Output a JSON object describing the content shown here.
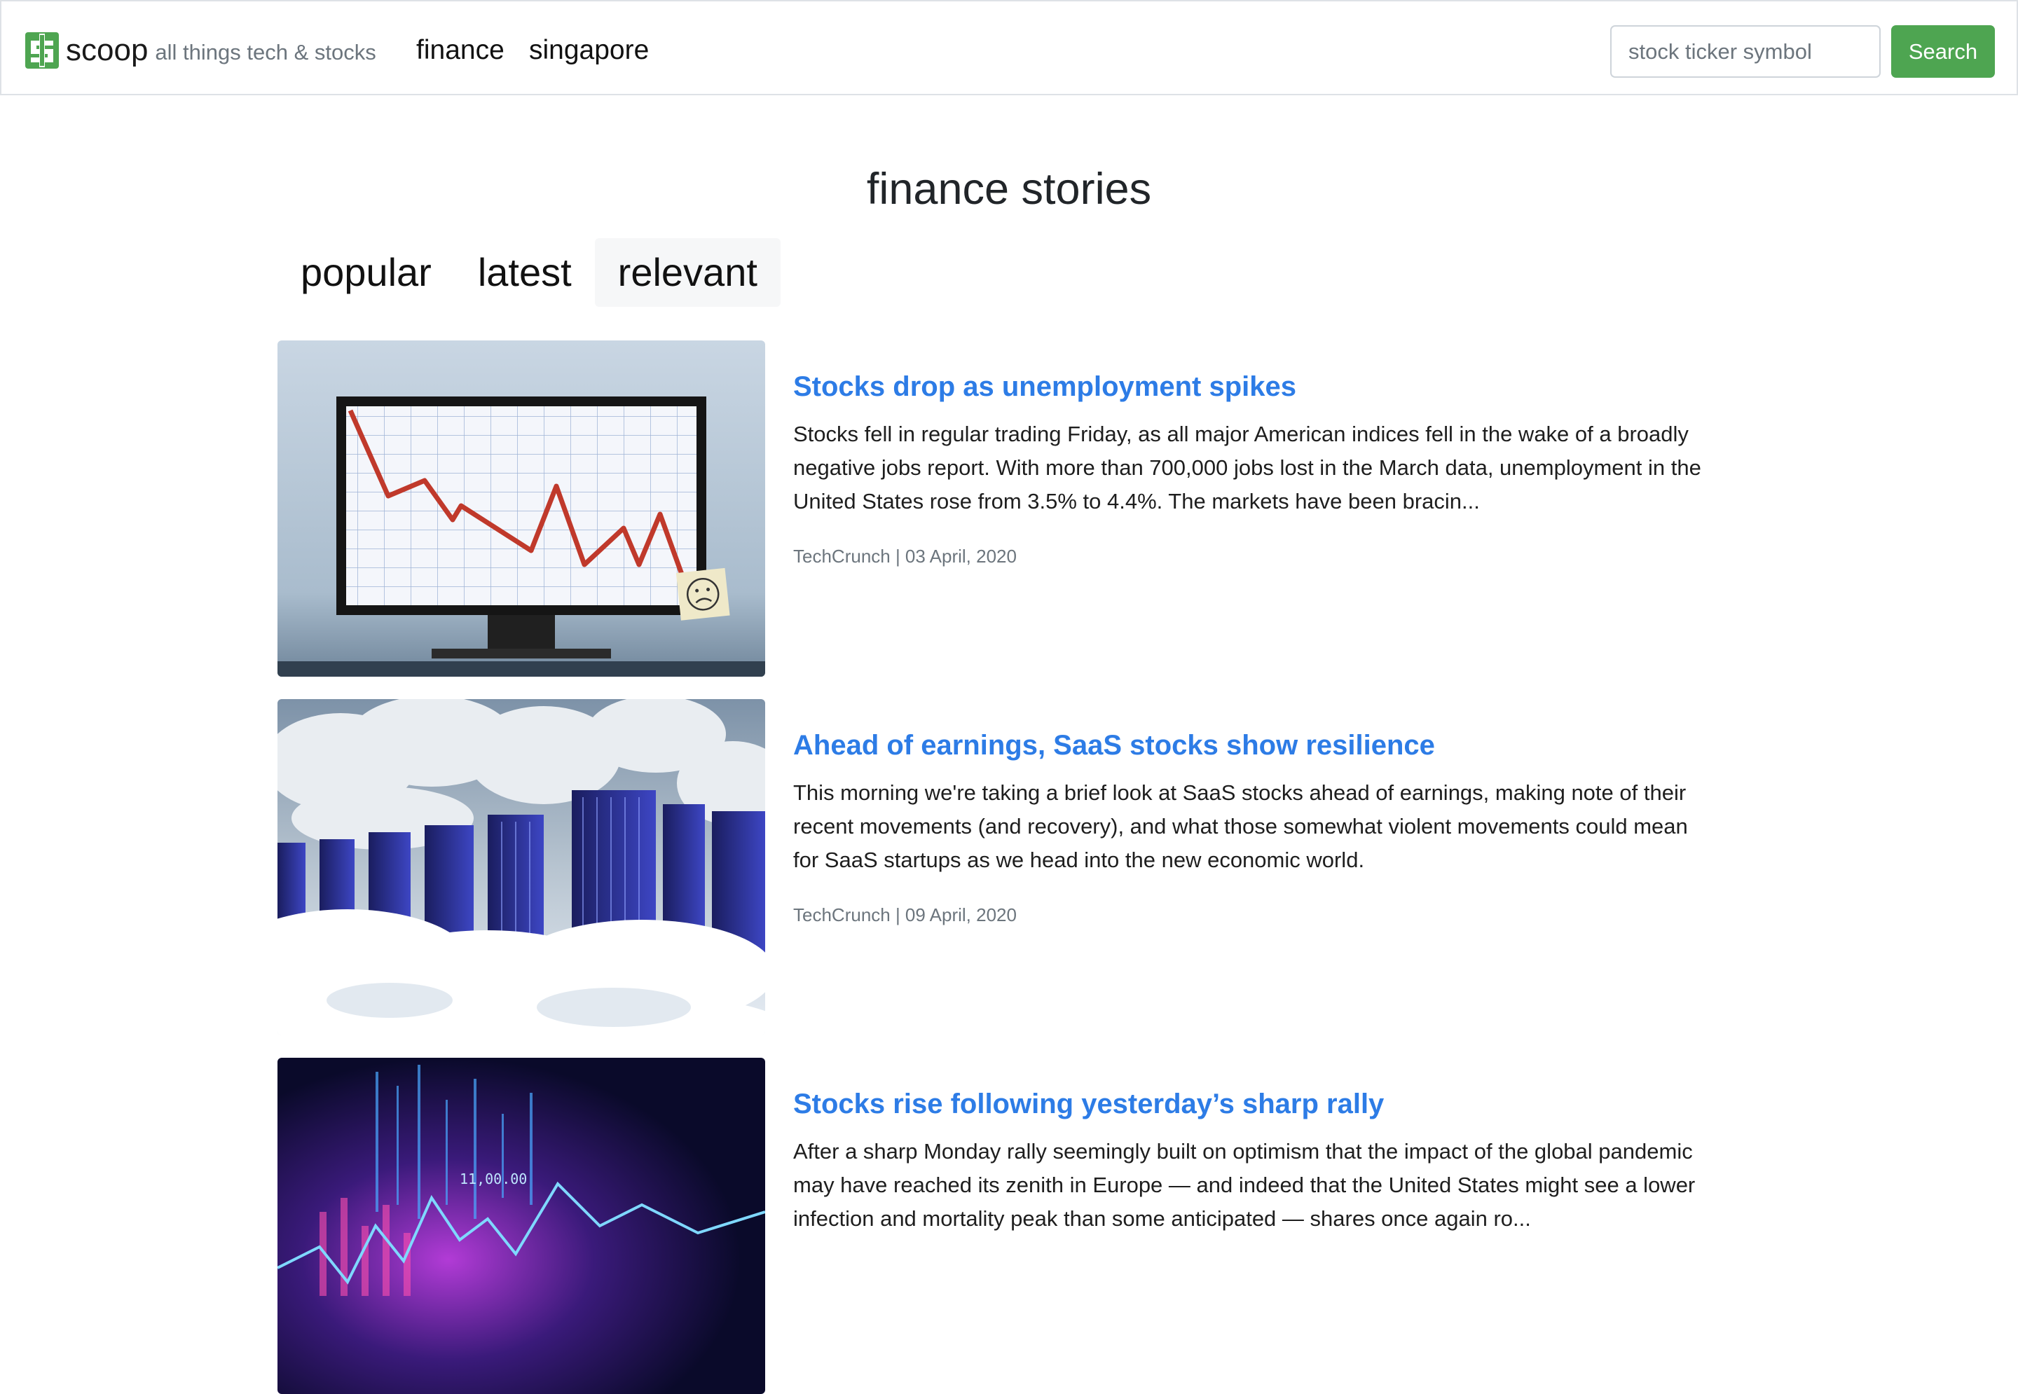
{
  "header": {
    "brand_name": "scoop",
    "brand_tagline": "all things tech & stocks",
    "nav": [
      {
        "label": "finance"
      },
      {
        "label": "singapore"
      }
    ],
    "search": {
      "placeholder": "stock ticker symbol",
      "value": "",
      "button_label": "Search"
    }
  },
  "page": {
    "title": "finance stories",
    "tabs": [
      {
        "label": "popular",
        "active": false
      },
      {
        "label": "latest",
        "active": false
      },
      {
        "label": "relevant",
        "active": true
      }
    ]
  },
  "stories": [
    {
      "title": "Stocks drop as unemployment spikes",
      "summary": "Stocks fell in regular trading Friday, as all major American indices fell in the wake of a broadly negative jobs report. With more than 700,000 jobs lost in the March data, unemployment in the United States rose from 3.5% to 4.4%. The markets have been bracin...",
      "meta": "TechCrunch | 03 April, 2020",
      "thumbnail": "falling-stock-chart-monitor"
    },
    {
      "title": "Ahead of earnings, SaaS stocks show resilience",
      "summary": "This morning we're taking a brief look at SaaS stocks ahead of earnings, making note of their recent movements (and recovery), and what those somewhat violent movements could mean for SaaS startups as we head into the new economic world.",
      "meta": "TechCrunch | 09 April, 2020",
      "thumbnail": "servers-in-clouds"
    },
    {
      "title": "Stocks rise following yesterday’s sharp rally",
      "summary": "After a sharp Monday rally seemingly built on optimism that the impact of the global pandemic may have reached its zenith in Europe — and indeed that the United States might see a lower infection and mortality peak than some anticipated — shares once again ro...",
      "meta": "",
      "thumbnail": "neon-financial-graph"
    }
  ],
  "colors": {
    "brand_green": "#4ea551",
    "link_blue": "#2d7ce6",
    "muted_text": "#6c757d",
    "active_tab_bg": "#f6f7f8"
  }
}
